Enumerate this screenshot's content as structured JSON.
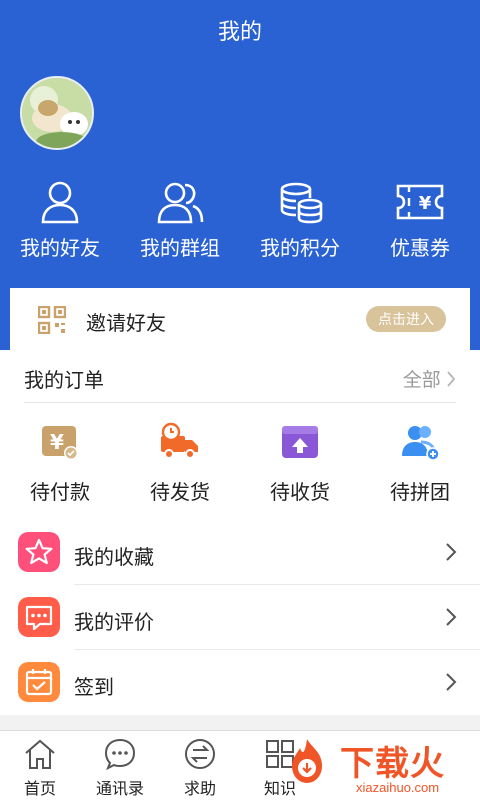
{
  "header": {
    "title": "我的"
  },
  "quick_links": [
    {
      "label": "我的好友",
      "icon": "person-icon"
    },
    {
      "label": "我的群组",
      "icon": "group-icon"
    },
    {
      "label": "我的积分",
      "icon": "coins-icon"
    },
    {
      "label": "优惠券",
      "icon": "coupon-icon"
    }
  ],
  "invite": {
    "label": "邀请好友",
    "button": "点击进入"
  },
  "orders": {
    "title": "我的订单",
    "all_label": "全部",
    "items": [
      {
        "label": "待付款",
        "icon": "yen-card-icon",
        "color": "#c9a26b"
      },
      {
        "label": "待发货",
        "icon": "truck-icon",
        "color": "#f26a2a"
      },
      {
        "label": "待收货",
        "icon": "box-up-icon",
        "color": "#8a58d6"
      },
      {
        "label": "待拼团",
        "icon": "group-plus-icon",
        "color": "#3a8ff0"
      }
    ]
  },
  "menu": [
    {
      "label": "我的收藏",
      "icon": "star-icon",
      "color": "#ff4f7b"
    },
    {
      "label": "我的评价",
      "icon": "comment-icon",
      "color": "#ff5c4a"
    },
    {
      "label": "签到",
      "icon": "calendar-check-icon",
      "color": "#ff8a3d"
    }
  ],
  "tabbar": [
    {
      "label": "首页",
      "icon": "home-icon"
    },
    {
      "label": "通讯录",
      "icon": "chat-icon"
    },
    {
      "label": "求助",
      "icon": "exchange-icon"
    },
    {
      "label": "知识",
      "icon": "grid-icon"
    }
  ],
  "watermark": {
    "text": "下载火",
    "domain": "xiazaihuo.com"
  },
  "colors": {
    "brand_blue": "#2a62d3",
    "gold": "#d8c39b"
  }
}
